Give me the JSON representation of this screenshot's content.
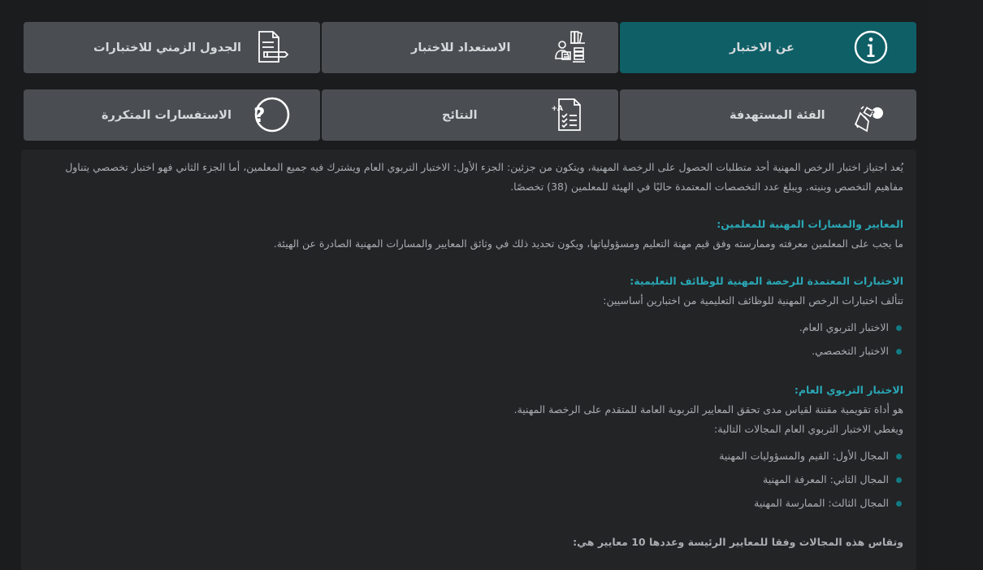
{
  "tabs": [
    {
      "id": "about",
      "label": "عن الاختبار",
      "icon": "info-icon",
      "active": true
    },
    {
      "id": "prep",
      "label": "الاستعداد للاختبار",
      "icon": "study-icon",
      "active": false
    },
    {
      "id": "schedule",
      "label": "الجدول الزمني للاختبارات",
      "icon": "document-pen-icon",
      "active": false
    },
    {
      "id": "audience",
      "label": "الفئة المستهدفة",
      "icon": "target-question-icon",
      "active": false
    },
    {
      "id": "results",
      "label": "النتائج",
      "icon": "grade-sheet-icon",
      "active": false
    },
    {
      "id": "faq",
      "label": "الاستفسارات المتكررة",
      "icon": "question-icon",
      "active": false
    }
  ],
  "content": {
    "intro": "يُعد اجتياز اختبار الرخص المهنية أحد متطلبات الحصول على الرخصة المهنية، ويتكون من جزئين: الجزء الأول: الاختبار التربوي العام ويشترك فيه جميع المعلمين، أما الجزء الثاني فهو اختبار تخصصي يتناول مفاهيم التخصص وبنيته. ويبلغ عدد التخصصات المعتمدة حاليًا في الهيئة للمعلمين (38) تخصصًا.",
    "standards_heading": "المعايير والمسارات المهنية للمعلمين:",
    "standards_text": "ما يجب على المعلمين معرفته وممارسته وفق قيم مهنة التعليم  ومسؤولياتها، ويكون تحديد ذلك في وثائق المعايير والمسارات المهنية الصادرة عن الهيئة.",
    "exams_heading": "الاختبارات المعتمدة للرخصة المهنية للوظائف التعليمية:",
    "exams_text": "تتألف اختبارات الرخص المهنية للوظائف التعليمية من اختبارين أساسيين:",
    "exams_list": [
      "الاختبار التربوي العام.",
      "الاختبار التخصصي."
    ],
    "general_heading": "الاختبار التربوي العام:",
    "general_text1": "هو أداة تقويمية مقننة لقياس مدى تحقق المعايير التربوية العامة للمتقدم على الرخصة المهنية.",
    "general_text2": "ويغطي الاختبار التربوي العام المجالات التالية:",
    "general_list": [
      "المجال الأول: القيم والمسؤوليات المهنية",
      "المجال الثاني: المعرفة المهنية",
      "المجال الثالث: الممارسة المهنية"
    ],
    "measure_heading": "وتقاس هذه المجالات وفقا للمعايير الرئيسة وعددها 10 معايير هي:"
  }
}
